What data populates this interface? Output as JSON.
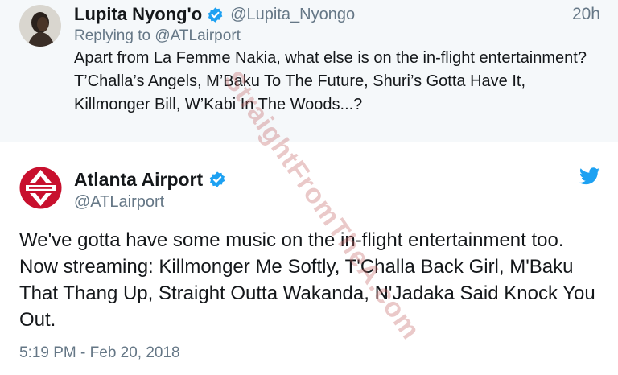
{
  "reply_tweet": {
    "name": "Lupita Nyong'o",
    "handle": "@Lupita_Nyongo",
    "time": "20h",
    "replying_prefix": "Replying to",
    "replying_to": "@ATLairport",
    "text": "Apart from La Femme Nakia, what else is on the in-flight entertainment? T’Challa’s Angels, M’Baku To The Future, Shuri’s Gotta Have It, Killmonger Bill, W’Kabi In The Woods...?"
  },
  "main_tweet": {
    "name": "Atlanta Airport",
    "handle": "@ATLairport",
    "text": "We've gotta have some music on the in-flight entertainment too. Now streaming: Killmonger Me Softly, T'Challa Back Girl, M'Baku That Thang Up, Straight Outta Wakanda, N'Jadaka Said Knock You Out.",
    "timestamp": "5:19 PM - Feb 20, 2018"
  },
  "watermark": "StraightFromTheA.com",
  "colors": {
    "verified_blue": "#1da1f2",
    "secondary_text": "#657786",
    "reply_background": "#f5f8fa",
    "atl_red": "#c8102e"
  },
  "icons": {
    "verified": "verified-badge-icon",
    "twitter": "twitter-bird-icon"
  }
}
